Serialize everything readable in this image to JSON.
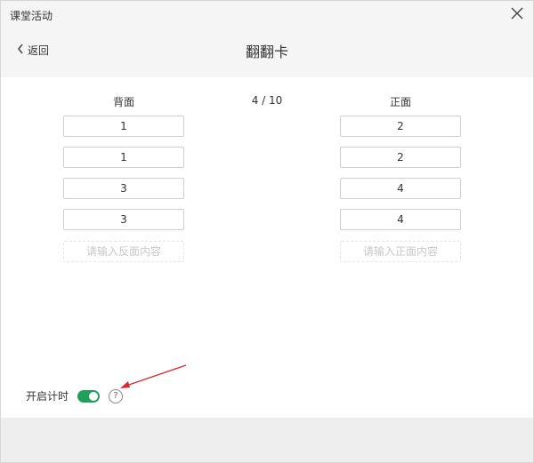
{
  "window": {
    "title": "课堂活动"
  },
  "header": {
    "back_label": "返回",
    "title": "翻翻卡"
  },
  "counter": "4 / 10",
  "columns": {
    "back_heading": "背面",
    "front_heading": "正面"
  },
  "cards": [
    {
      "back": "1",
      "front": "2"
    },
    {
      "back": "1",
      "front": "2"
    },
    {
      "back": "3",
      "front": "4"
    },
    {
      "back": "3",
      "front": "4"
    }
  ],
  "placeholders": {
    "back": "请输入反面内容",
    "front": "请输入正面内容"
  },
  "timer": {
    "label": "开启计时",
    "enabled": true,
    "help_symbol": "?"
  },
  "colors": {
    "toggle_on": "#20a05a",
    "annotation_arrow": "#d9242a"
  },
  "icons": [
    "close-icon",
    "chevron-left-icon",
    "help-circle-icon"
  ]
}
